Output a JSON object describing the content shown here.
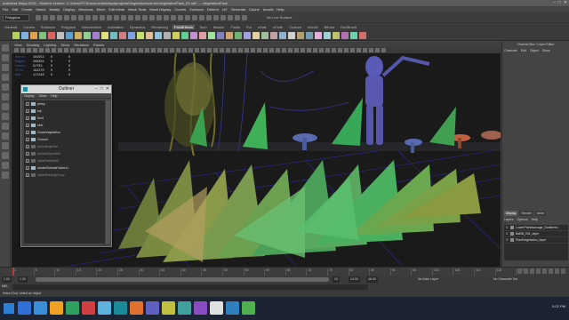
{
  "window": {
    "title": "Autodesk Maya 2016 - Student Version: C:\\Users\\PC\\Documents\\Maya\\projects\\Vegetation\\scenes\\VegetationPack_01.mb* --- VegetationPack",
    "controls": [
      "–",
      "□",
      "✕"
    ]
  },
  "menubar": [
    "File",
    "Edit",
    "Create",
    "Select",
    "Modify",
    "Display",
    "Windows",
    "Mesh",
    "Edit Mesh",
    "Mesh Tools",
    "Mesh Display",
    "Curves",
    "Surfaces",
    "Deform",
    "UV",
    "Generate",
    "Cache",
    "Arnold",
    "Help"
  ],
  "statusline": {
    "mode": "Polygons",
    "live": "No Live Surface"
  },
  "shelf": {
    "tabs": [
      "General",
      "Curves",
      "Surfaces",
      "Polygons",
      "Deformation",
      "Animation",
      "Dynamics",
      "Rendering",
      "PaintEffects",
      "Toon",
      "Muscle",
      "Fluids",
      "Fur",
      "nHair",
      "nCloth",
      "Custom",
      "Arnold",
      "Bifrost",
      "GoZBrush"
    ],
    "active_tab": "PaintEffects",
    "icon_colors": [
      "#b0d060",
      "#7fb3e0",
      "#e0a050",
      "#80c080",
      "#e06060",
      "#c0c0c0",
      "#60a0d0",
      "#d0b060",
      "#90d090",
      "#a080d0",
      "#e0e080",
      "#70c0c0",
      "#d08080",
      "#80a0e0",
      "#c0e070",
      "#e0c090",
      "#90c0e0",
      "#b0b0b0",
      "#d0d060",
      "#60d090",
      "#c090d0",
      "#e0a0a0",
      "#a0e0a0",
      "#8080c0",
      "#d0a070",
      "#70b070",
      "#a0a0e0",
      "#e0d0a0",
      "#a0c0a0",
      "#c0a0a0",
      "#90b0d0",
      "#d0d0d0",
      "#b0a070",
      "#70a0b0",
      "#e0b0e0",
      "#a0d0d0",
      "#c0c070",
      "#b070b0",
      "#70d0b0",
      "#d07070"
    ]
  },
  "viewport": {
    "panel_menu": [
      "View",
      "Shading",
      "Lighting",
      "Show",
      "Renderer",
      "Panels"
    ],
    "hud": [
      {
        "label": "Verts:",
        "a": "101553",
        "b": "0",
        "c": "0"
      },
      {
        "label": "Edges:",
        "a": "208304",
        "b": "0",
        "c": "0"
      },
      {
        "label": "Faces:",
        "a": "92703",
        "b": "0",
        "c": "0"
      },
      {
        "label": "Tris:",
        "a": "192370",
        "b": "0",
        "c": "0"
      },
      {
        "label": "UVs:",
        "a": "117448",
        "b": "0",
        "c": "0"
      }
    ]
  },
  "outliner": {
    "title": "Outliner",
    "menu": [
      "Display",
      "Show",
      "Help"
    ],
    "items": [
      {
        "label": "persp",
        "dim": false
      },
      {
        "label": "top",
        "dim": false
      },
      {
        "label": "front",
        "dim": false
      },
      {
        "label": "side",
        "dim": false
      },
      {
        "label": "GrassVegetation",
        "dim": false
      },
      {
        "label": "Ground",
        "dim": false
      },
      {
        "label": "defaultLightSet",
        "dim": true
      },
      {
        "label": "defaultObjectSet",
        "dim": true
      },
      {
        "label": "initialParticleSE",
        "dim": true
      },
      {
        "label": "strokeGlobalsFolders1",
        "dim": false
      },
      {
        "label": "initialShadingGroup",
        "dim": true
      }
    ]
  },
  "channelbox": {
    "title": "Channel Box / Layer Editor",
    "menu": [
      "Channels",
      "Edit",
      "Object",
      "Show"
    ],
    "tabs": [
      "Display",
      "Render",
      "Anim"
    ],
    "active_tab": "Display",
    "submenu": [
      "Layers",
      "Options",
      "Help"
    ],
    "layers": [
      {
        "v": "V",
        "name": "LowerPlantAverage_Scattered"
      },
      {
        "v": "V",
        "name": "BaBB_001_layer"
      },
      {
        "v": "V",
        "name": "PlantVegetation_layer"
      }
    ]
  },
  "timeline": {
    "ticks": [
      "1",
      "5",
      "10",
      "15",
      "20",
      "25",
      "30",
      "35",
      "40",
      "45",
      "50",
      "55",
      "60",
      "65",
      "70",
      "75",
      "80",
      "85",
      "90",
      "95",
      "100",
      "105",
      "110",
      "115",
      "120"
    ],
    "current_frame": "1.00"
  },
  "range": {
    "start": "1.00",
    "inner_start": "1.00",
    "inner_end": "24",
    "end": "24.00",
    "end2": "48.00",
    "anim_layer": "No Anim Layer",
    "char_set": "No Character Set"
  },
  "cmdline": {
    "label": "MEL"
  },
  "helpline": {
    "text": "Select Tool: select an object"
  },
  "taskbar": {
    "icon_colors": [
      "#2f6fd6",
      "#3c8fd6",
      "#f0a020",
      "#2fa060",
      "#d04040",
      "#60b0e0",
      "#1b8a9a",
      "#e07030",
      "#6060c0",
      "#c0c040",
      "#40a0a0",
      "#8a4cc0",
      "#e0e0e0",
      "#3080c0",
      "#50b050"
    ],
    "clock": "5:02 PM"
  }
}
